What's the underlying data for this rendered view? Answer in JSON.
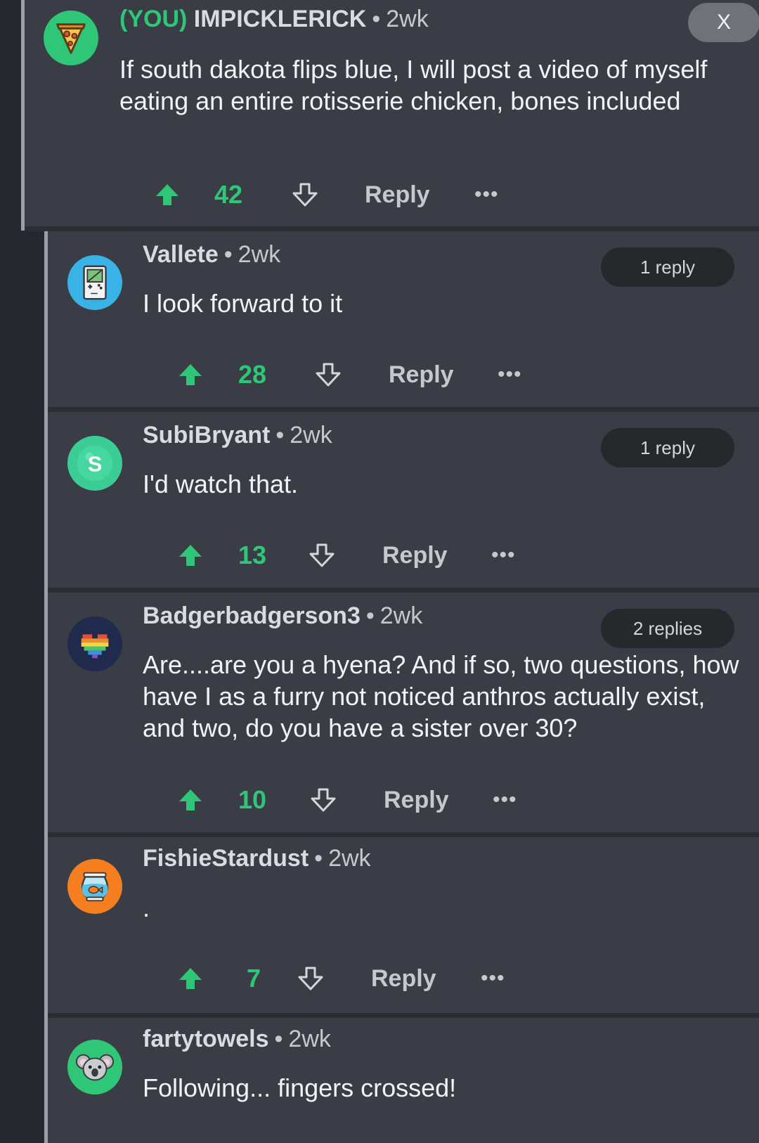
{
  "colors": {
    "background": "#3a3d46",
    "rail": "#26282d",
    "accent_green": "#2fc677",
    "text": "#f2f3f5",
    "muted": "#c5c8ce"
  },
  "close_label": "X",
  "comments": [
    {
      "you_tag": "(YOU)",
      "username": "IMPICKLERICK",
      "time": "2wk",
      "text": "If south dakota flips blue, I will post a video of myself eating an entire rotisserie chicken, bones included",
      "score": "42",
      "reply_label": "Reply",
      "more_label": "•••",
      "avatar_icon": "pizza-icon",
      "avatar_color": "#2fc677"
    },
    {
      "username": "Vallete",
      "time": "2wk",
      "text": "I look forward to it",
      "score": "28",
      "replies_badge": "1 reply",
      "reply_label": "Reply",
      "more_label": "•••",
      "avatar_icon": "gameboy-icon",
      "avatar_color": "#39b3e6"
    },
    {
      "username": "SubiBryant",
      "time": "2wk",
      "text": "I'd watch that.",
      "score": "13",
      "replies_badge": "1 reply",
      "reply_label": "Reply",
      "more_label": "•••",
      "avatar_icon": "letter-s-icon",
      "avatar_letter": "S",
      "avatar_color": "#3ccc96"
    },
    {
      "username": "Badgerbadgerson3",
      "time": "2wk",
      "text": "Are....are you a hyena? And if so, two questions, how have I as a furry not noticed anthros actually exist, and two, do you have a sister over 30?",
      "score": "10",
      "replies_badge": "2 replies",
      "reply_label": "Reply",
      "more_label": "•••",
      "avatar_icon": "rainbow-heart-icon",
      "avatar_color": "#1f2a4d"
    },
    {
      "username": "FishieStardust",
      "time": "2wk",
      "text": ".",
      "score": "7",
      "reply_label": "Reply",
      "more_label": "•••",
      "avatar_icon": "fishbowl-icon",
      "avatar_color": "#f57e20"
    },
    {
      "username": "fartytowels",
      "time": "2wk",
      "text": "Following... fingers crossed!",
      "avatar_icon": "koala-icon",
      "avatar_color": "#2fc677"
    }
  ]
}
